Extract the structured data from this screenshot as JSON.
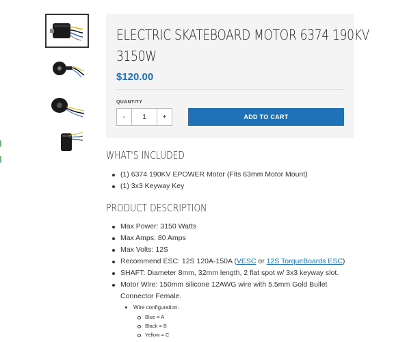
{
  "gallery": {
    "thumbnails": [
      {
        "icon": "motor-front-image",
        "active": true
      },
      {
        "icon": "motor-side-image",
        "active": false
      },
      {
        "icon": "motor-angle-image",
        "active": false
      },
      {
        "icon": "motor-back-image",
        "active": false
      }
    ]
  },
  "product": {
    "title_line1": "ELECTRIC SKATEBOARD MOTOR 6374 190KV",
    "title_line2": "3150W",
    "price": "$120.00",
    "quantity_label": "QUANTITY",
    "quantity_value": "1",
    "decrement_label": "-",
    "increment_label": "+",
    "add_to_cart_label": "ADD TO CART",
    "accent_color": "#1f71b8"
  },
  "included": {
    "heading": "WHAT'S INCLUDED",
    "items": [
      "(1) 6374 190KV EPOWER Motor (Fits 63mm Motor Mount)",
      "(1) 3x3 Keyway Key"
    ]
  },
  "description": {
    "heading": "PRODUCT DESCRIPTION",
    "items": [
      "Max Power: 3150 Watts",
      "Max Amps: 80 Amps",
      "Max Volts: 12S"
    ],
    "esc": {
      "prefix": "Recommend ESC: 12S 120A-150A (",
      "link1": "VESC",
      "middle": " or ",
      "link2": "12S TorqueBoards ESC",
      "suffix": ")"
    },
    "shaft": "SHAFT: Diameter 8mm, 32mm length, 2 flat spot w/ 3x3 keyway slot.",
    "wire_line1": "Motor Wire: 150mm silicone 12AWG wire with 5.5mm Gold Bullet",
    "wire_line2": "Connector Female.",
    "wire_config": {
      "label": "Wire configuration:",
      "items": [
        "Blue = A",
        "Black = B",
        "Yellow = C"
      ]
    }
  }
}
